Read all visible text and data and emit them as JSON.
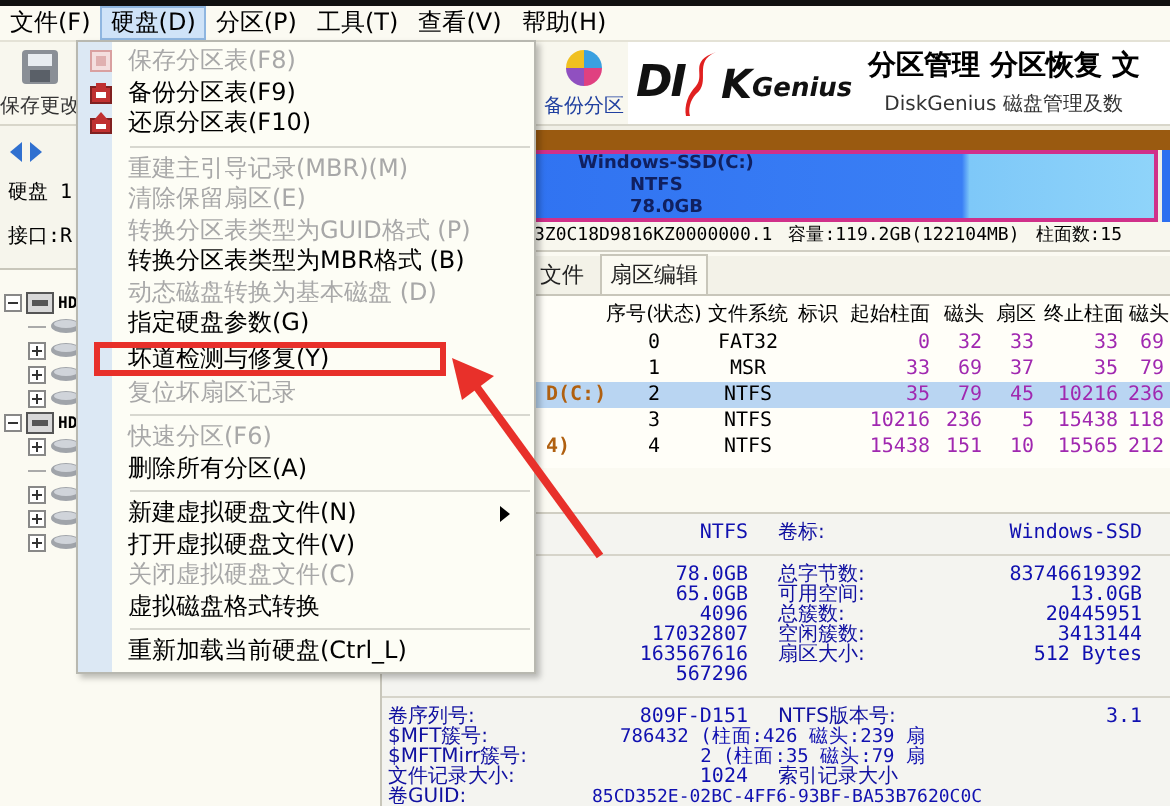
{
  "menu_bar": [
    {
      "label": "文件(F)",
      "selected": false
    },
    {
      "label": "硬盘(D)",
      "selected": true
    },
    {
      "label": "分区(P)",
      "selected": false
    },
    {
      "label": "工具(T)",
      "selected": false
    },
    {
      "label": "查看(V)",
      "selected": false
    },
    {
      "label": "帮助(H)",
      "selected": false
    }
  ],
  "toolbar": {
    "save_button": "保存更改",
    "backup_button": "备份分区",
    "logo": {
      "left": "DI",
      "right": "K",
      "suffix": "Genius"
    },
    "slogan": "分区管理 分区恢复 文",
    "subtitle": "DiskGenius 磁盘管理及数"
  },
  "disk_panel": {
    "disk_label": "硬盘 1",
    "interface_label": "接口:R"
  },
  "tree": [
    {
      "label": "HD",
      "expanded": true,
      "children": [
        {
          "expandable": false
        },
        {
          "expandable": true
        },
        {
          "expandable": true
        },
        {
          "expandable": true
        }
      ]
    },
    {
      "label": "HD",
      "expanded": true,
      "children": [
        {
          "expandable": true
        },
        {
          "expandable": false
        },
        {
          "expandable": true
        },
        {
          "expandable": true
        },
        {
          "expandable": true
        }
      ]
    }
  ],
  "disk_map": {
    "partition": [
      "Windows-SSD(C:)",
      "NTFS",
      "78.0GB"
    ]
  },
  "disk_info": {
    "serial": "3Z0C18D9816KZ0000000.1",
    "capacity": "容量:119.2GB(122104MB)",
    "cylinders": "柱面数:15"
  },
  "tabs": [
    {
      "label": "文件",
      "selected": false
    },
    {
      "label": "扇区编辑",
      "selected": true
    }
  ],
  "table": {
    "columns": [
      "序号(状态)",
      "文件系统",
      "标识",
      "起始柱面",
      "磁头",
      "扇区",
      "终止柱面",
      "磁头"
    ],
    "rows": [
      {
        "name": "",
        "selected": false,
        "cells": [
          "0",
          "FAT32",
          "",
          "0",
          "32",
          "33",
          "33",
          "69"
        ]
      },
      {
        "name": "",
        "selected": false,
        "cells": [
          "1",
          "MSR",
          "",
          "33",
          "69",
          "37",
          "35",
          "79"
        ]
      },
      {
        "name": "D(C:)",
        "selected": true,
        "cells": [
          "2",
          "NTFS",
          "",
          "35",
          "79",
          "45",
          "10216",
          "236"
        ]
      },
      {
        "name": "",
        "selected": false,
        "cells": [
          "3",
          "NTFS",
          "",
          "10216",
          "236",
          "5",
          "15438",
          "118"
        ]
      },
      {
        "name": "4)",
        "selected": false,
        "cells": [
          "4",
          "NTFS",
          "",
          "15438",
          "151",
          "10",
          "15565",
          "212"
        ]
      }
    ]
  },
  "details": {
    "rows": [
      {
        "kind": "pair",
        "label": "",
        "value": "NTFS",
        "label_2": "卷标:",
        "value_2": "Windows-SSD"
      },
      {
        "kind": "rule"
      },
      {
        "kind": "pair",
        "label": "",
        "value": "78.0GB",
        "label_2": "总字节数:",
        "value_2": "83746619392"
      },
      {
        "kind": "pair",
        "label": "",
        "value": "65.0GB",
        "label_2": "可用空间:",
        "value_2": "13.0GB"
      },
      {
        "kind": "pair",
        "label": "",
        "value": "4096",
        "label_2": "总簇数:",
        "value_2": "20445951"
      },
      {
        "kind": "pair",
        "label": "",
        "value": "17032807",
        "label_2": "空闲簇数:",
        "value_2": "3413144"
      },
      {
        "kind": "pair",
        "label": "",
        "value": "163567616",
        "label_2": "扇区大小:",
        "value_2": "512 Bytes"
      },
      {
        "kind": "pair",
        "label": "",
        "value": "567296",
        "label_2": "",
        "value_2": ""
      },
      {
        "kind": "rule"
      },
      {
        "kind": "pair",
        "label": "卷序列号:",
        "value": "809F-D151",
        "label_2": "NTFS版本号:",
        "value_2": "3.1"
      },
      {
        "kind": "wide",
        "label": "$MFT簇号:",
        "value": "786432 (柱面:426 磁头:239 扇"
      },
      {
        "kind": "wide",
        "label": "$MFTMirr簇号:",
        "value": "2 (柱面:35 磁头:79 扇"
      },
      {
        "kind": "pair",
        "label": "文件记录大小:",
        "value": "1024",
        "label_2": "索引记录大小",
        "value_2": ""
      },
      {
        "kind": "guid",
        "label": "卷GUID:",
        "value": "85CD352E-02BC-4FF6-93BF-BA53B7620C0C"
      }
    ]
  },
  "dropdown": [
    {
      "kind": "item",
      "label": "保存分区表(F8)",
      "disabled": true
    },
    {
      "kind": "item",
      "label": "备份分区表(F9)",
      "disabled": false
    },
    {
      "kind": "item",
      "label": "还原分区表(F10)",
      "disabled": false
    },
    {
      "kind": "separator"
    },
    {
      "kind": "item",
      "label": "重建主引导记录(MBR)(M)",
      "disabled": true
    },
    {
      "kind": "item",
      "label": "清除保留扇区(E)",
      "disabled": true
    },
    {
      "kind": "item",
      "label": "转换分区表类型为GUID格式 (P)",
      "disabled": true
    },
    {
      "kind": "item",
      "label": "转换分区表类型为MBR格式 (B)",
      "disabled": false
    },
    {
      "kind": "item",
      "label": "动态磁盘转换为基本磁盘 (D)",
      "disabled": true
    },
    {
      "kind": "item",
      "label": "指定硬盘参数(G)",
      "disabled": false
    },
    {
      "kind": "item",
      "label": "坏道检测与修复(Y)",
      "disabled": false,
      "callout": true
    },
    {
      "kind": "item",
      "label": "复位坏扇区记录",
      "disabled": true
    },
    {
      "kind": "separator"
    },
    {
      "kind": "item",
      "label": "快速分区(F6)",
      "disabled": true
    },
    {
      "kind": "item",
      "label": "删除所有分区(A)",
      "disabled": false
    },
    {
      "kind": "separator"
    },
    {
      "kind": "item",
      "label": "新建虚拟硬盘文件(N)",
      "disabled": false,
      "submenu": true
    },
    {
      "kind": "item",
      "label": "打开虚拟硬盘文件(V)",
      "disabled": false
    },
    {
      "kind": "item",
      "label": "关闭虚拟硬盘文件(C)",
      "disabled": true
    },
    {
      "kind": "item",
      "label": "虚拟磁盘格式转换",
      "disabled": false
    },
    {
      "kind": "separator"
    },
    {
      "kind": "item",
      "label": "重新加载当前硬盘(Ctrl_L)",
      "disabled": false
    }
  ]
}
